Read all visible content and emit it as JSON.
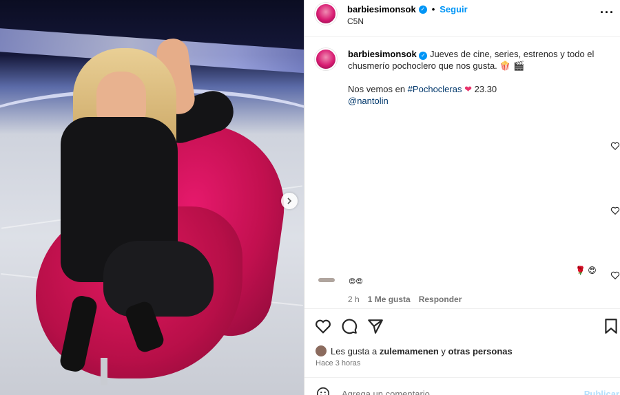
{
  "post": {
    "username": "barbiesimonsok",
    "verified": true,
    "follow_label": "Seguir",
    "location": "C5N",
    "separator": "•"
  },
  "caption": {
    "username": "barbiesimonsok",
    "line1": "Jueves de cine, series, estrenos y todo el chusmerío pochoclero que nos gusta. 🍿 🎬",
    "line2_prefix": "Nos vemos en ",
    "hashtag": "#Pochocleras",
    "heart": "❤",
    "time_text": " 23.30",
    "mention": "@nantolin"
  },
  "comments": {
    "emojis": "🌹 😍",
    "partial_emoji": "😍😍",
    "time": "2 h",
    "likes": "1 Me gusta",
    "reply": "Responder"
  },
  "likes_line": {
    "prefix": "Les gusta a ",
    "user": "zulemamenen",
    "conjunction": " y ",
    "others": "otras personas"
  },
  "time_ago": "Hace 3 horas",
  "comment_box": {
    "placeholder": "Agrega un comentario...",
    "post_label": "Publicar"
  },
  "colors": {
    "accent": "#0095f6",
    "link": "#00376b",
    "muted": "#737373"
  }
}
